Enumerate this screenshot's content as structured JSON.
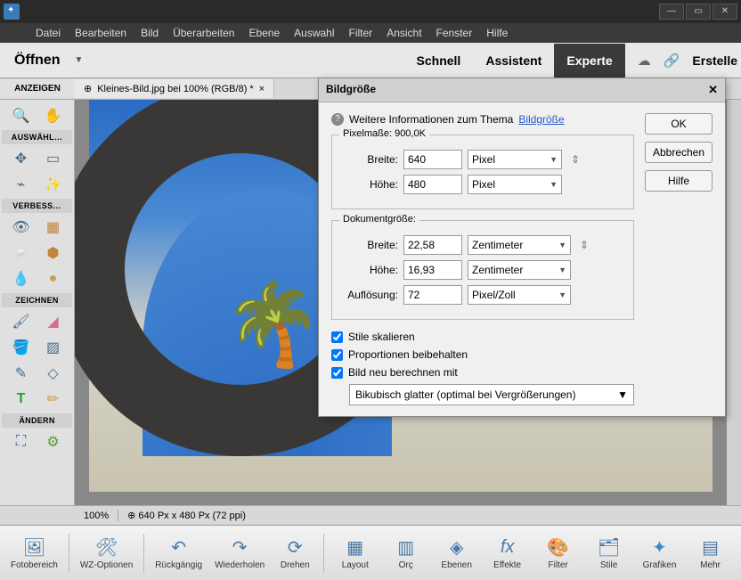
{
  "menu": [
    "Datei",
    "Bearbeiten",
    "Bild",
    "Überarbeiten",
    "Ebene",
    "Auswahl",
    "Filter",
    "Ansicht",
    "Fenster",
    "Hilfe"
  ],
  "modebar": {
    "open": "Öffnen",
    "modes": [
      "Schnell",
      "Assistent",
      "Experte"
    ],
    "active": "Experte",
    "erstellen": "Erstelle"
  },
  "toolbox": {
    "anzeigen": "ANZEIGEN",
    "auswaehl": "AUSWÄHL…",
    "verbess": "VERBESS…",
    "zeichnen": "ZEICHNEN",
    "aendern": "ÄNDERN"
  },
  "doc_tab": "Kleines-Bild.jpg bei 100% (RGB/8) *",
  "status": {
    "zoom": "100%",
    "dims": "640 Px x 480 Px (72 ppi)"
  },
  "bottom": [
    "Fotobereich",
    "WZ-Optionen",
    "Rückgängig",
    "Wiederholen",
    "Drehen",
    "Layout",
    "Orç",
    "Ebenen",
    "Effekte",
    "Filter",
    "Stile",
    "Grafiken",
    "Mehr"
  ],
  "dialog": {
    "title": "Bildgröße",
    "info_text": "Weitere Informationen zum Thema",
    "info_link": "Bildgröße",
    "buttons": {
      "ok": "OK",
      "cancel": "Abbrechen",
      "help": "Hilfe"
    },
    "pixel_legend": "Pixelmaße: 900,0K",
    "doc_legend": "Dokumentgröße:",
    "labels": {
      "breite": "Breite:",
      "hoehe": "Höhe:",
      "aufloesung": "Auflösung:"
    },
    "px_w": "640",
    "px_h": "480",
    "px_unit": "Pixel",
    "doc_w": "22,58",
    "doc_h": "16,93",
    "doc_unit": "Zentimeter",
    "res": "72",
    "res_unit": "Pixel/Zoll",
    "chk": {
      "stile": "Stile skalieren",
      "prop": "Proportionen beibehalten",
      "resample": "Bild neu berechnen mit"
    },
    "resample_method": "Bikubisch glatter (optimal bei Vergrößerungen)"
  }
}
